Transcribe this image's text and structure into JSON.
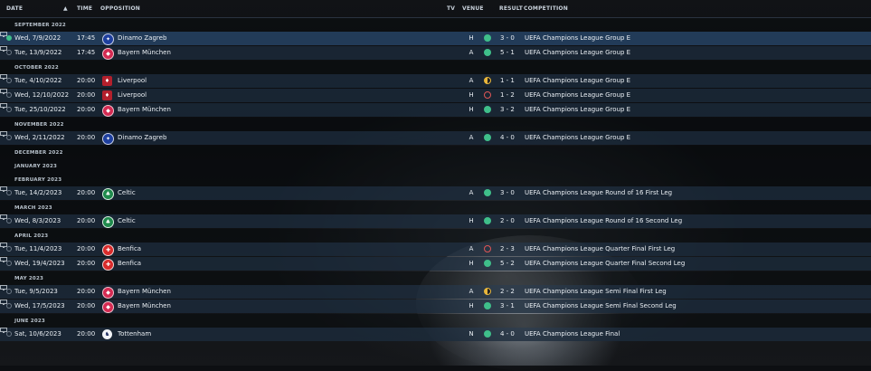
{
  "header": {
    "date": "DATE",
    "time": "TIME",
    "opposition": "OPPOSITION",
    "tv": "TV",
    "venue": "VENUE",
    "result": "RESULT",
    "competition": "COMPETITION",
    "sort_indicator": "▲"
  },
  "colors": {
    "win": "#3fbf8a",
    "loss": "#e05656",
    "draw": "#e8b63b",
    "row": "#1c2c3c",
    "selected_row": "#243e5c"
  },
  "months": [
    "SEPTEMBER 2022",
    "OCTOBER 2022",
    "NOVEMBER 2022",
    "DECEMBER 2022",
    "JANUARY 2023",
    "FEBRUARY 2023",
    "MARCH 2023",
    "APRIL 2023",
    "MAY 2023",
    "JUNE 2023"
  ],
  "fixtures": [
    {
      "date": "Wed, 7/9/2022",
      "time": "17:45",
      "opponent": "Dinamo Zagreb",
      "venue": "H",
      "result": "3 - 0",
      "outcome": "win",
      "competition": "UEFA Champions League Group E",
      "crest": "dinamo-zagreb-crest-icon"
    },
    {
      "date": "Tue, 13/9/2022",
      "time": "17:45",
      "opponent": "Bayern München",
      "venue": "A",
      "result": "5 - 1",
      "outcome": "win",
      "competition": "UEFA Champions League Group E",
      "crest": "bayern-crest-icon"
    },
    {
      "date": "Tue, 4/10/2022",
      "time": "20:00",
      "opponent": "Liverpool",
      "venue": "A",
      "result": "1 - 1",
      "outcome": "draw",
      "competition": "UEFA Champions League Group E",
      "crest": "liverpool-crest-icon"
    },
    {
      "date": "Wed, 12/10/2022",
      "time": "20:00",
      "opponent": "Liverpool",
      "venue": "H",
      "result": "1 - 2",
      "outcome": "loss",
      "competition": "UEFA Champions League Group E",
      "crest": "liverpool-crest-icon"
    },
    {
      "date": "Tue, 25/10/2022",
      "time": "20:00",
      "opponent": "Bayern München",
      "venue": "H",
      "result": "3 - 2",
      "outcome": "win",
      "competition": "UEFA Champions League Group E",
      "crest": "bayern-crest-icon"
    },
    {
      "date": "Wed, 2/11/2022",
      "time": "20:00",
      "opponent": "Dinamo Zagreb",
      "venue": "A",
      "result": "4 - 0",
      "outcome": "win",
      "competition": "UEFA Champions League Group E",
      "crest": "dinamo-zagreb-crest-icon"
    },
    {
      "date": "Tue, 14/2/2023",
      "time": "20:00",
      "opponent": "Celtic",
      "venue": "A",
      "result": "3 - 0",
      "outcome": "win",
      "competition": "UEFA Champions League Round of 16 First Leg",
      "crest": "celtic-crest-icon"
    },
    {
      "date": "Wed, 8/3/2023",
      "time": "20:00",
      "opponent": "Celtic",
      "venue": "H",
      "result": "2 - 0",
      "outcome": "win",
      "competition": "UEFA Champions League Round of 16 Second Leg",
      "crest": "celtic-crest-icon"
    },
    {
      "date": "Tue, 11/4/2023",
      "time": "20:00",
      "opponent": "Benfica",
      "venue": "A",
      "result": "2 - 3",
      "outcome": "loss",
      "competition": "UEFA Champions League Quarter Final First Leg",
      "crest": "benfica-crest-icon"
    },
    {
      "date": "Wed, 19/4/2023",
      "time": "20:00",
      "opponent": "Benfica",
      "venue": "H",
      "result": "5 - 2",
      "outcome": "win",
      "competition": "UEFA Champions League Quarter Final Second Leg",
      "crest": "benfica-crest-icon"
    },
    {
      "date": "Tue, 9/5/2023",
      "time": "20:00",
      "opponent": "Bayern München",
      "venue": "A",
      "result": "2 - 2",
      "outcome": "draw",
      "competition": "UEFA Champions League Semi Final First Leg",
      "crest": "bayern-crest-icon"
    },
    {
      "date": "Wed, 17/5/2023",
      "time": "20:00",
      "opponent": "Bayern München",
      "venue": "H",
      "result": "3 - 1",
      "outcome": "win",
      "competition": "UEFA Champions League Semi Final Second Leg",
      "crest": "bayern-crest-icon"
    },
    {
      "date": "Sat, 10/6/2023",
      "time": "20:00",
      "opponent": "Tottenham",
      "venue": "N",
      "result": "4 - 0",
      "outcome": "win",
      "competition": "UEFA Champions League Final",
      "crest": "tottenham-crest-icon"
    }
  ]
}
